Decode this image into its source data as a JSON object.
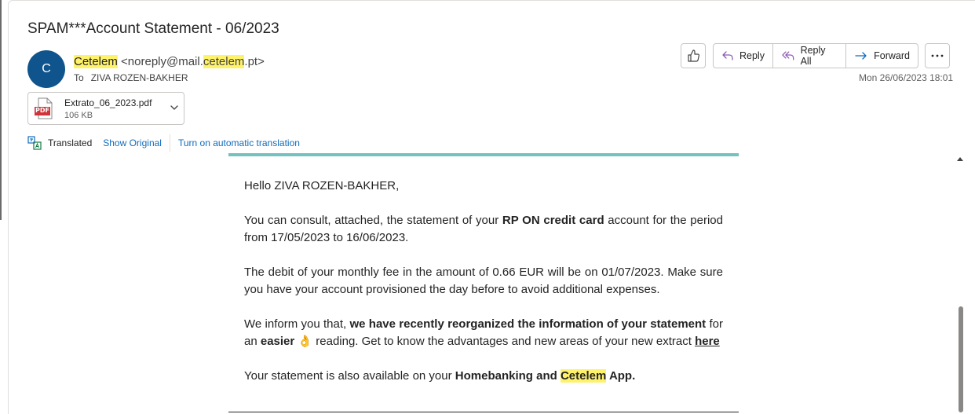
{
  "email": {
    "subject": "SPAM***Account Statement - 06/2023",
    "avatar_letter": "C",
    "sender_name": "Cetelem",
    "sender_addr_pre": "<noreply@mail.",
    "sender_addr_hl": "cetelem",
    "sender_addr_post": ".pt>",
    "to_label": "To",
    "to_name": "ZIVA ROZEN-BAKHER",
    "date": "Mon 26/06/2023 18:01"
  },
  "actions": {
    "reply": "Reply",
    "reply_all": "Reply All",
    "forward": "Forward"
  },
  "attachment": {
    "name": "Extrato_06_2023.pdf",
    "size": "106 KB",
    "badge": "PDF"
  },
  "translation": {
    "label": "Translated",
    "show_original": "Show Original",
    "auto": "Turn on automatic translation"
  },
  "body": {
    "greeting": "Hello ZIVA ROZEN-BAKHER,",
    "p1_a": "You can consult, attached, the statement of your ",
    "p1_b": "RP ON credit card",
    "p1_c": " account for the period from 17/05/2023 to 16/06/2023.",
    "p2": "The debit of your monthly fee in the amount of 0.66 EUR will be on 01/07/2023. Make sure you have your account provisioned the day before to avoid additional expenses.",
    "p3_a": "We inform you that, ",
    "p3_b": "we have recently reorganized the information of your statement",
    "p3_c": " for an ",
    "p3_d": "easier",
    "p3_emoji": "👌",
    "p3_e": " reading. Get to know the advantages and new areas of your new extract ",
    "p3_link": "here",
    "p4_a": "Your statement is also available on your ",
    "p4_b": "Homebanking and ",
    "p4_c": "Cetelem",
    "p4_d": " App."
  },
  "colors": {
    "avatar": "#0f548c",
    "highlight": "#fff26b",
    "link": "#0f6cbd",
    "teal_bar": "#74c1be",
    "pdf_red": "#d13438"
  }
}
